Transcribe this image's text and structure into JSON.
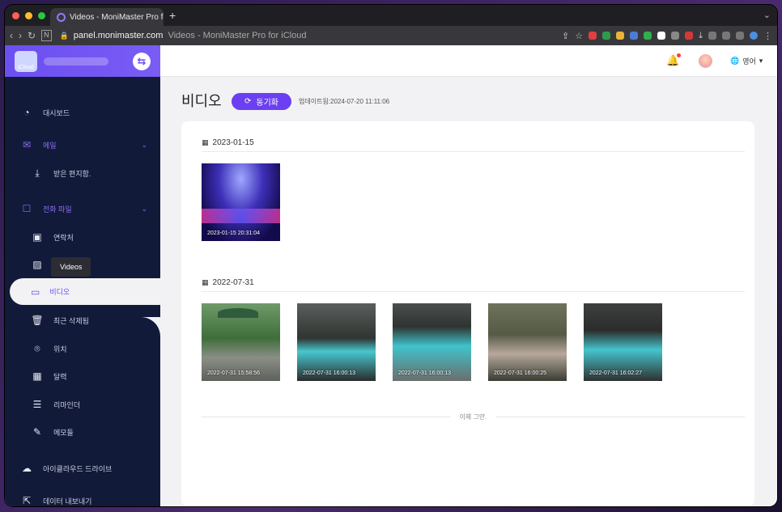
{
  "browser": {
    "tab_title": "Videos - MoniMaster Pro for iC",
    "new_tab": "+",
    "url_host": "panel.monimaster.com",
    "url_title": "Videos - MoniMaster Pro for iCloud"
  },
  "app": {
    "logo_text": "iCloud",
    "nav": [
      {
        "label": "대시보드",
        "icon": "dashboard-icon"
      },
      {
        "label": "메일",
        "icon": "mail-icon"
      },
      {
        "label": "받은 편지함.",
        "icon": "inbox-icon"
      },
      {
        "label": "전화 파일",
        "icon": "phone-files-icon"
      },
      {
        "label": "연락처",
        "icon": "contacts-icon"
      },
      {
        "label": "Photos",
        "icon": "photo-icon"
      },
      {
        "label": "비디오",
        "icon": "video-icon"
      },
      {
        "label": "최근 삭제됨",
        "icon": "trash-icon"
      },
      {
        "label": "위치",
        "icon": "location-icon"
      },
      {
        "label": "달력",
        "icon": "calendar-icon"
      },
      {
        "label": "리마인더",
        "icon": "reminder-icon"
      },
      {
        "label": "메모들",
        "icon": "notes-icon"
      },
      {
        "label": "아이클라우드 드라이브",
        "icon": "cloud-icon"
      },
      {
        "label": "데이터 내보내기",
        "icon": "export-icon"
      }
    ],
    "tooltip": "Videos",
    "header": {
      "language": "영어"
    },
    "page": {
      "title": "비디오",
      "sync_button": "동기화",
      "updated": "업데이트됨:2024-07-20 11:11:06"
    },
    "groups": [
      {
        "date": "2023-01-15",
        "videos": [
          {
            "timestamp": "2023-01-15   20:31:04"
          }
        ]
      },
      {
        "date": "2022-07-31",
        "videos": [
          {
            "timestamp": "2022-07-31   15:58:56"
          },
          {
            "timestamp": "2022-07-31   16:00:13"
          },
          {
            "timestamp": "2022-07-31   16:00:13"
          },
          {
            "timestamp": "2022-07-31   16:00:25"
          },
          {
            "timestamp": "2022-07-31   16:02:27"
          }
        ]
      }
    ],
    "end_text": "이제 그만."
  },
  "colors": {
    "accent": "#6b3ff2",
    "sidebar": "#121a3a",
    "brand": "#7a5cf5"
  }
}
